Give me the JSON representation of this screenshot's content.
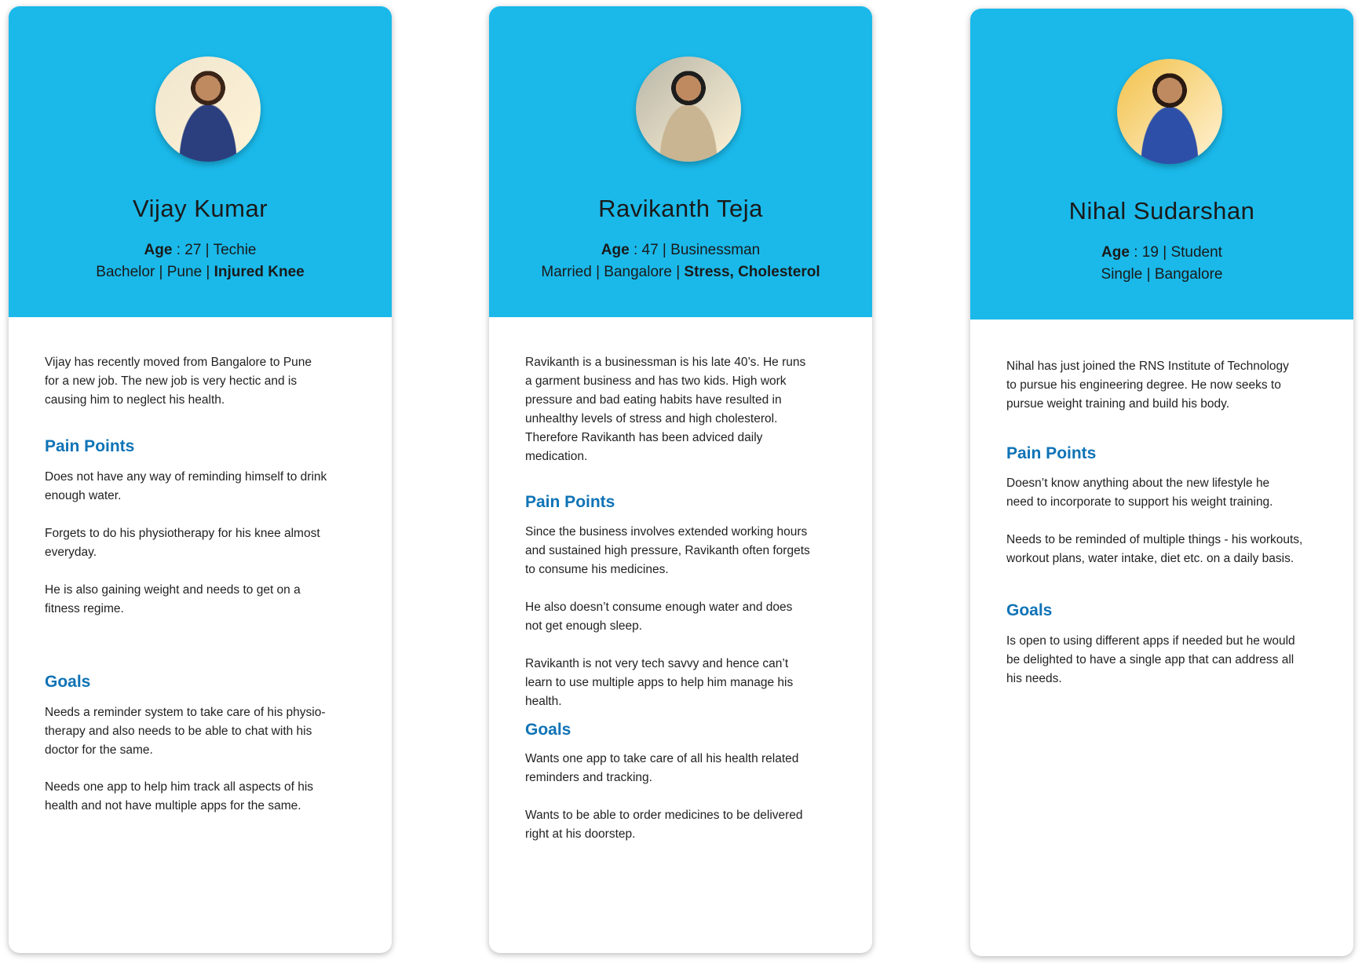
{
  "colors": {
    "header": "#1ab9ea",
    "heading": "#0f73b6"
  },
  "personas": [
    {
      "name": "Vijay Kumar",
      "age_label": "Age",
      "age": "27",
      "occupation": "Techie",
      "line2_plain": "Bachelor | Pune | ",
      "line2_bold": "Injured Knee",
      "avatar_colors": [
        "#efe6cf",
        "#2b3f7f",
        "#3a2418"
      ],
      "description": [
        "Vijay has recently moved from Bangalore to Pune",
        "for a new job. The new job is very hectic and is",
        "causing him to neglect his health."
      ],
      "pain_title": "Pain Points",
      "pain_points": [
        [
          "Does not have any way of reminding himself to drink",
          "enough water."
        ],
        [
          "Forgets to do his physiotherapy for his knee almost",
          "everyday."
        ],
        [
          "He is also gaining weight and needs to get on a",
          "fitness regime."
        ]
      ],
      "goals_title": "Goals",
      "goals": [
        [
          "Needs a reminder system to take care of his physio-",
          "therapy and also needs to be able to chat with his",
          "doctor for the same."
        ],
        [
          "Needs one app to help him track all aspects of his",
          "health and not have multiple apps for the same."
        ]
      ]
    },
    {
      "name": "Ravikanth Teja",
      "age_label": "Age",
      "age": "47",
      "occupation": "Businessman",
      "line2_plain": "Married | Bangalore | ",
      "line2_bold": "Stress, Cholesterol",
      "avatar_colors": [
        "#b8b6a8",
        "#c9b592",
        "#1d1d1d"
      ],
      "description": [
        "Ravikanth is a businessman is his late 40’s. He runs",
        "a garment business and has two kids. High work",
        "pressure and bad eating habits have resulted in",
        "unhealthy levels of stress and high cholesterol.",
        "Therefore Ravikanth has been adviced daily",
        "medication."
      ],
      "pain_title": "Pain Points",
      "pain_points": [
        [
          "Since the business involves extended working hours",
          "and sustained high pressure, Ravikanth often forgets",
          "to consume his medicines."
        ],
        [
          "He also doesn’t consume enough water and does",
          "not get enough sleep."
        ],
        [
          "Ravikanth is not very tech savvy and hence can’t",
          "learn to use multiple apps to help him manage his",
          "health."
        ]
      ],
      "goals_title": "Goals",
      "goals": [
        [
          "Wants one app to take care of all his health related",
          "reminders and tracking."
        ],
        [
          "Wants to be able to order medicines to be delivered",
          "right at his doorstep."
        ]
      ]
    },
    {
      "name": "Nihal Sudarshan",
      "age_label": "Age",
      "age": "19",
      "occupation": "Student",
      "line2_plain": "Single | Bangalore",
      "line2_bold": "",
      "avatar_colors": [
        "#f2c14a",
        "#2e4fa8",
        "#2a1a12"
      ],
      "description": [
        "Nihal has just joined the RNS Institute of Technology",
        "to pursue his engineering degree. He now seeks to",
        "pursue weight training and build his body."
      ],
      "pain_title": "Pain Points",
      "pain_points": [
        [
          "Doesn’t know anything about the new lifestyle he",
          "need to incorporate to support his weight training."
        ],
        [
          "Needs to be reminded of multiple things - his workouts,",
          "workout plans, water intake, diet etc. on a daily basis."
        ]
      ],
      "goals_title": "Goals",
      "goals": [
        [
          "Is open to using different apps if needed but he would",
          "be delighted to have a  single app that can address all",
          "his needs."
        ]
      ]
    }
  ]
}
